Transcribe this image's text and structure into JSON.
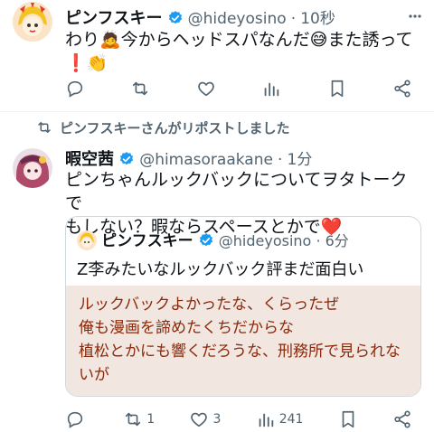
{
  "tweet1": {
    "name": "ピンフスキー",
    "handle": "@hideyosino",
    "separator": "·",
    "time": "10秒",
    "line1": "わり🙇今からヘッドスパなんだ😅また誘って",
    "line2": "❗👏"
  },
  "repost_banner": {
    "text": "ピンフスキーさんがリポストしました"
  },
  "tweet2": {
    "name": "暇空茜",
    "handle": "@himasoraakane",
    "separator": "·",
    "time": "1分",
    "line1": "ピンちゃんルックバックについてヲタトークで",
    "line2": "もしない？暇ならスペースとかで❤️",
    "reply_count": "",
    "retweet_count": "1",
    "like_count": "3",
    "view_count": "241"
  },
  "quote": {
    "name": "ピンフスキー",
    "handle": "@hideyosino",
    "separator": "·",
    "time": "6分",
    "text": "Z李みたいなルックバック評まだ面白い",
    "lines": [
      "ルックバックよかったな、くらったぜ",
      "俺も漫画を諦めたくちだからな",
      "植松とかにも響くだろうな、刑務所で見られな",
      "いが"
    ]
  },
  "colors": {
    "verified": "#1d9bf0",
    "icon_gray": "#536471",
    "quote_highlight_bg": "#f2e6e1",
    "quote_text": "#8a2a0a"
  }
}
